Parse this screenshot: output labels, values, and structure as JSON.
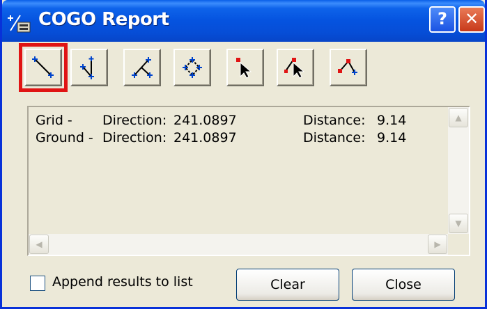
{
  "window": {
    "title": "COGO Report",
    "help_label": "?",
    "close_label": "✕",
    "title_icon": "cogo-report-icon"
  },
  "toolbar": {
    "tools": [
      {
        "name": "line-tool-icon",
        "selected": true
      },
      {
        "name": "angle-tool-icon",
        "selected": false
      },
      {
        "name": "triangle-tool-icon",
        "selected": false
      },
      {
        "name": "circle-tool-icon",
        "selected": false
      },
      {
        "name": "select-point-icon",
        "selected": false
      },
      {
        "name": "select-vertex-icon",
        "selected": false
      },
      {
        "name": "vertex-angle-icon",
        "selected": false
      }
    ]
  },
  "report": {
    "rows": [
      {
        "label": "Grid -",
        "direction_label": "Direction:",
        "direction": "241.0897",
        "distance_label": "Distance:",
        "distance": "9.14"
      },
      {
        "label": "Ground -",
        "direction_label": "Direction:",
        "direction": "241.0897",
        "distance_label": "Distance:",
        "distance": "9.14"
      }
    ]
  },
  "append_checkbox": {
    "label": "Append results to list",
    "checked": false
  },
  "buttons": {
    "clear_label": "Clear",
    "close_label": "Close"
  },
  "scroll_icons": {
    "up": "▲",
    "down": "▼",
    "left": "◀",
    "right": "▶"
  },
  "colors": {
    "title_bar": "#0553DF",
    "selection_highlight": "#E01414",
    "face": "#ECE9D8"
  }
}
